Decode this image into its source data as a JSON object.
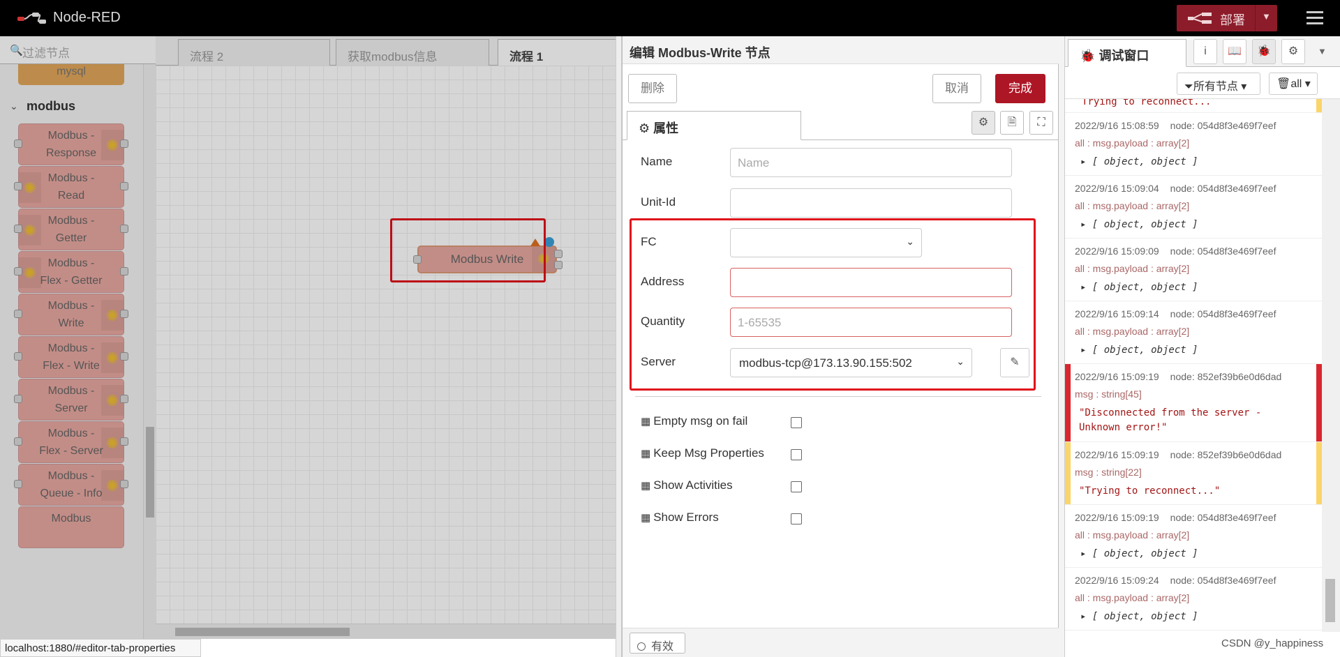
{
  "header": {
    "title": "Node-RED",
    "deploy_label": "部署",
    "colors": {
      "header_bg": "#666666",
      "deploy_bg": "#8c1c2a"
    }
  },
  "palette": {
    "filter_placeholder": "过滤节点",
    "top_node": "mysql",
    "category": "modbus",
    "nodes": [
      {
        "l1": "Modbus -",
        "l2": "Response",
        "icon": "right"
      },
      {
        "l1": "Modbus -",
        "l2": "Read",
        "icon": "left"
      },
      {
        "l1": "Modbus -",
        "l2": "Getter",
        "icon": "left"
      },
      {
        "l1": "Modbus -",
        "l2": "Flex - Getter",
        "icon": "left"
      },
      {
        "l1": "Modbus -",
        "l2": "Write",
        "icon": "right"
      },
      {
        "l1": "Modbus -",
        "l2": "Flex - Write",
        "icon": "right"
      },
      {
        "l1": "Modbus -",
        "l2": "Server",
        "icon": "right"
      },
      {
        "l1": "Modbus -",
        "l2": "Flex - Server",
        "icon": "right"
      },
      {
        "l1": "Modbus -",
        "l2": "Queue - Info",
        "icon": "right"
      },
      {
        "l1": "Modbus",
        "l2": "",
        "icon": "none"
      }
    ]
  },
  "workspace": {
    "tabs": [
      "流程 2",
      "获取modbus信息",
      "流程 1"
    ],
    "active_tab": "流程 1",
    "node_label": "Modbus Write"
  },
  "editor": {
    "title": "编辑 Modbus-Write 节点",
    "delete_label": "删除",
    "cancel_label": "取消",
    "done_label": "完成",
    "tab_label": "属性",
    "fields": {
      "name": {
        "label": "Name",
        "placeholder": "Name",
        "value": ""
      },
      "unit_id": {
        "label": "Unit-Id",
        "value": ""
      },
      "fc": {
        "label": "FC",
        "value": ""
      },
      "address": {
        "label": "Address",
        "value": ""
      },
      "quantity": {
        "label": "Quantity",
        "placeholder": "1-65535",
        "value": ""
      },
      "server": {
        "label": "Server",
        "value": "modbus-tcp@173.13.90.155:502"
      }
    },
    "checkboxes": [
      "Empty msg on fail",
      "Keep Msg Properties",
      "Show Activities",
      "Show Errors"
    ],
    "enabled_label": "有效"
  },
  "sidebar": {
    "tab_label": "调试窗口",
    "filter_label": "所有节点",
    "clear_label": "all",
    "partial_top": "Trying to reconnect...",
    "messages": [
      {
        "time": "2022/9/16 15:08:59",
        "node": "node: 054d8f3e469f7eef",
        "topic": "all : msg.payload : array[2]",
        "payload": "[ object, object ]",
        "level": ""
      },
      {
        "time": "2022/9/16 15:09:04",
        "node": "node: 054d8f3e469f7eef",
        "topic": "all : msg.payload : array[2]",
        "payload": "[ object, object ]",
        "level": ""
      },
      {
        "time": "2022/9/16 15:09:09",
        "node": "node: 054d8f3e469f7eef",
        "topic": "all : msg.payload : array[2]",
        "payload": "[ object, object ]",
        "level": ""
      },
      {
        "time": "2022/9/16 15:09:14",
        "node": "node: 054d8f3e469f7eef",
        "topic": "all : msg.payload : array[2]",
        "payload": "[ object, object ]",
        "level": ""
      },
      {
        "time": "2022/9/16 15:09:19",
        "node": "node: 852ef39b6e0d6dad",
        "topic": "msg : string[45]",
        "payload": "\"Disconnected from the server -\nUnknown error!\"",
        "level": "error"
      },
      {
        "time": "2022/9/16 15:09:19",
        "node": "node: 852ef39b6e0d6dad",
        "topic": "msg : string[22]",
        "payload": "\"Trying to reconnect...\"",
        "level": "warn"
      },
      {
        "time": "2022/9/16 15:09:19",
        "node": "node: 054d8f3e469f7eef",
        "topic": "all : msg.payload : array[2]",
        "payload": "[ object, object ]",
        "level": ""
      },
      {
        "time": "2022/9/16 15:09:24",
        "node": "node: 054d8f3e469f7eef",
        "topic": "all : msg.payload : array[2]",
        "payload": "[ object, object ]",
        "level": ""
      }
    ]
  },
  "status_url": "localhost:1880/#editor-tab-properties",
  "watermark": "CSDN @y_happiness"
}
